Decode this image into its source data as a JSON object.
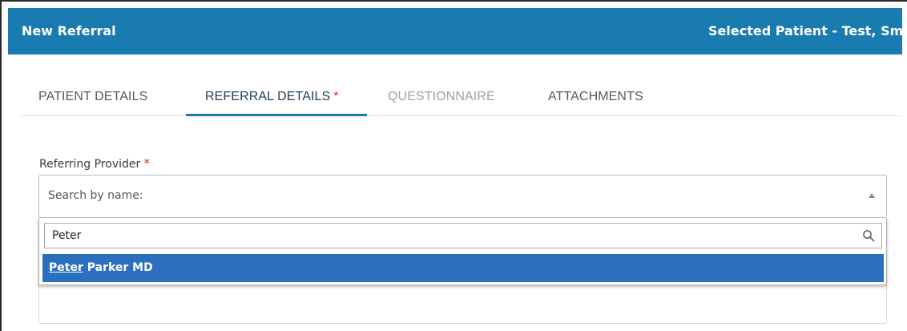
{
  "header": {
    "title": "New Referral",
    "patient": "Selected Patient - Test, Sm",
    "color": "#1a7bb0"
  },
  "tabs": [
    {
      "label": "PATIENT DETAILS",
      "state": "normal"
    },
    {
      "label": "REFERRAL DETAILS",
      "state": "active",
      "required_mark": "*"
    },
    {
      "label": "QUESTIONNAIRE",
      "state": "disabled"
    },
    {
      "label": "ATTACHMENTS",
      "state": "normal"
    }
  ],
  "form": {
    "referring_provider": {
      "label": "Referring Provider",
      "required_mark": "*",
      "placeholder": "Search by name:",
      "search_value": "Peter",
      "results": [
        {
          "match": "Peter",
          "rest": " Parker MD",
          "highlighted": true
        }
      ]
    }
  },
  "colors": {
    "required": "#d9342b",
    "highlight": "#2d6fbf"
  },
  "icons": {
    "search": "search-icon",
    "select_arrow": "caret-up-icon"
  }
}
